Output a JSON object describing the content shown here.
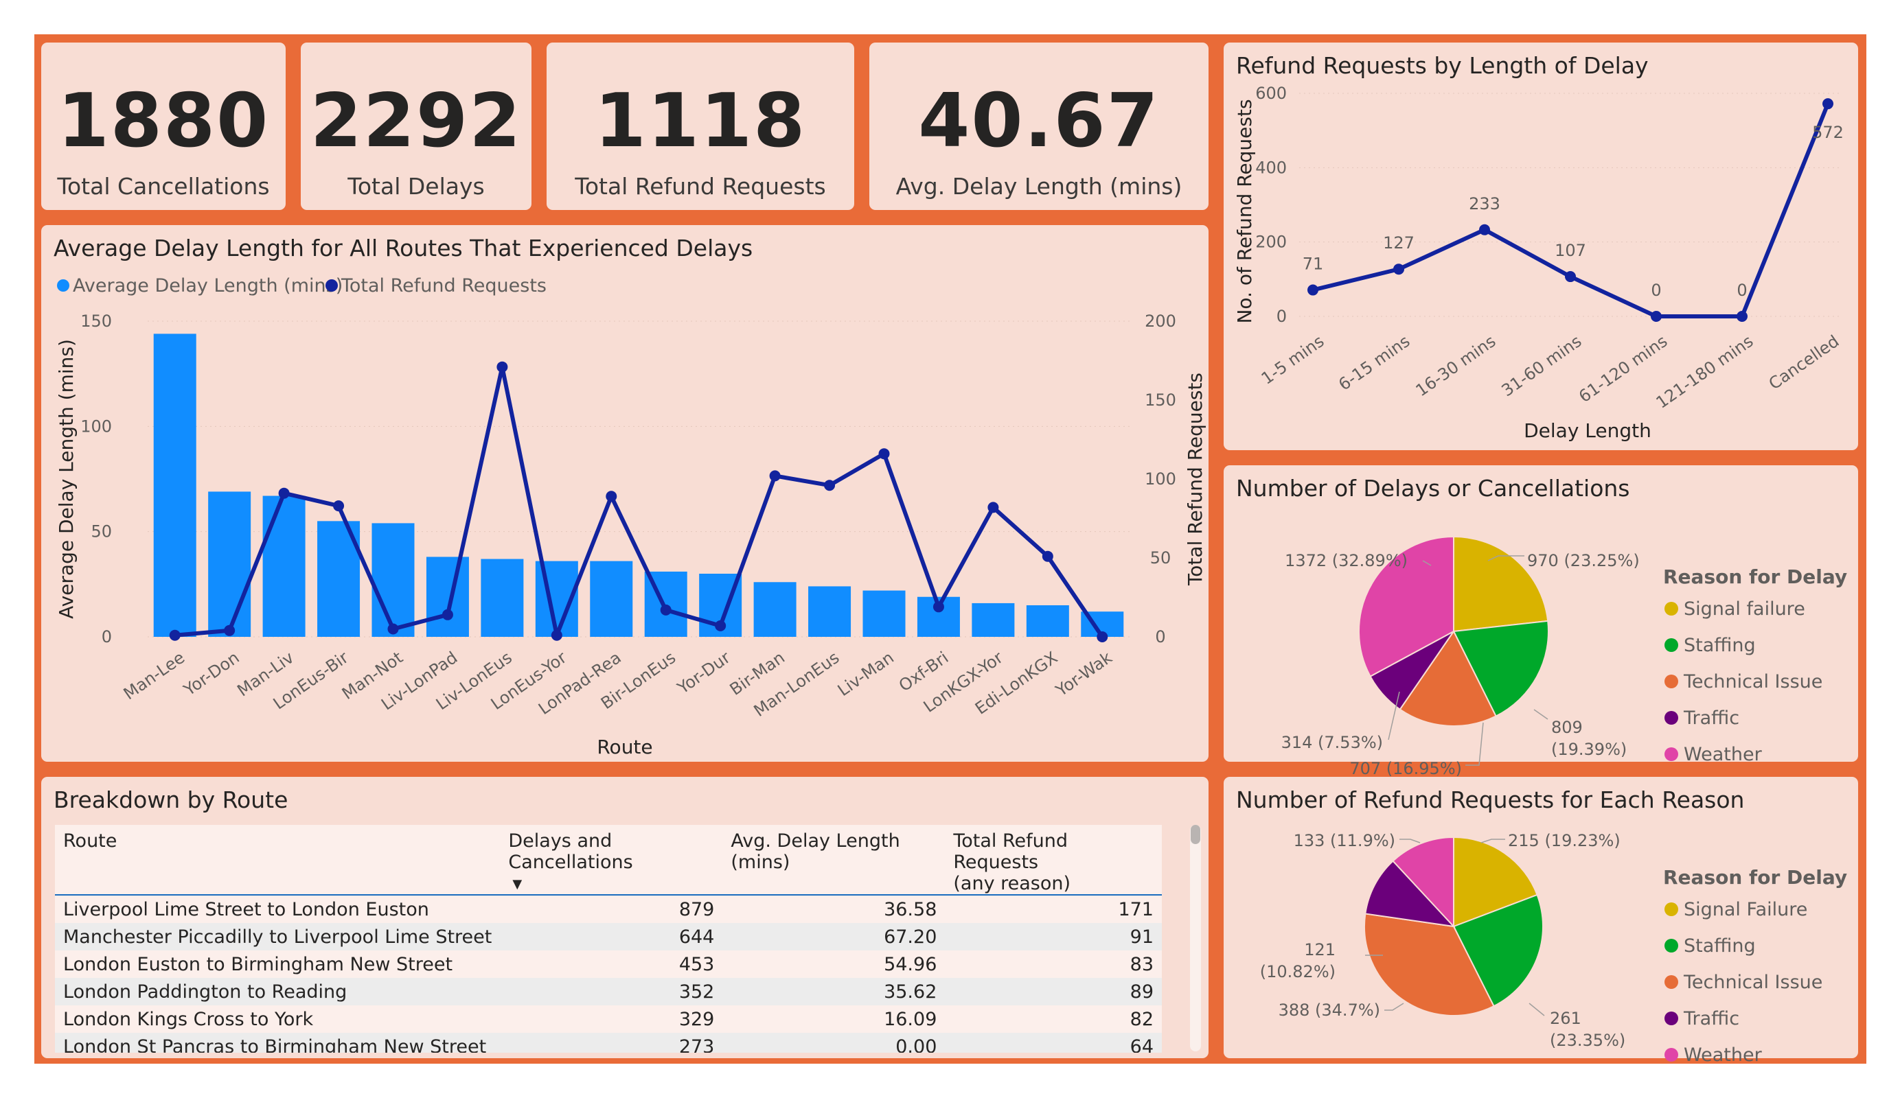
{
  "kpis": [
    {
      "value": "1880",
      "label": "Total Cancellations"
    },
    {
      "value": "2292",
      "label": "Total Delays"
    },
    {
      "value": "1118",
      "label": "Total Refund Requests"
    },
    {
      "value": "40.67",
      "label": "Avg. Delay Length (mins)"
    }
  ],
  "colors": {
    "background": "#e96b38",
    "card": "#f8ddd4",
    "bar": "#118dff",
    "line": "#12239e",
    "signal": "#d9b300",
    "staffing": "#00a82a",
    "technical": "#e66c37",
    "traffic": "#6b007b",
    "weather": "#e044a7"
  },
  "chart_data": [
    {
      "type": "bar",
      "title": "Average Delay Length for All Routes That Experienced Delays",
      "xlabel": "Route",
      "ylabel": "Average Delay Length (mins)",
      "y2label": "Total Refund Requests",
      "ylim": [
        0,
        150
      ],
      "y2lim": [
        0,
        200
      ],
      "yticks": [
        "150",
        "100",
        "50",
        "0"
      ],
      "y2ticks": [
        "200",
        "150",
        "100",
        "50",
        "0"
      ],
      "legend_position": "top-left",
      "categories": [
        "Man-Lee",
        "Yor-Don",
        "Man-Liv",
        "LonEus-Bir",
        "Man-Not",
        "Liv-LonPad",
        "Liv-LonEus",
        "LonEus-Yor",
        "LonPad-Rea",
        "Bir-LonEus",
        "Yor-Dur",
        "Bir-Man",
        "Man-LonEus",
        "Liv-Man",
        "Oxf-Bri",
        "LonKGX-Yor",
        "Edi-LonKGX",
        "Yor-Wak"
      ],
      "series": [
        {
          "name": "Average Delay Length (mins)",
          "kind": "bar",
          "axis": "left",
          "values": [
            144,
            69,
            67,
            55,
            54,
            38,
            37,
            36,
            36,
            31,
            30,
            26,
            24,
            22,
            19,
            16,
            15,
            12
          ]
        },
        {
          "name": "Total Refund Requests",
          "kind": "line",
          "axis": "right",
          "values": [
            1,
            4,
            91,
            83,
            5,
            14,
            171,
            1,
            89,
            17,
            7,
            102,
            96,
            116,
            19,
            82,
            51,
            0
          ]
        }
      ]
    },
    {
      "type": "line",
      "title": "Refund Requests by Length of Delay",
      "xlabel": "Delay Length",
      "ylabel": "No. of Refund Requests",
      "ylim": [
        0,
        600
      ],
      "yticks": [
        "600",
        "400",
        "200",
        "0"
      ],
      "categories": [
        "1-5 mins",
        "6-15 mins",
        "16-30 mins",
        "31-60 mins",
        "61-120 mins",
        "121-180 mins",
        "Cancelled"
      ],
      "values": [
        71,
        127,
        233,
        107,
        0,
        0,
        572
      ],
      "data_labels": [
        "71",
        "127",
        "233",
        "107",
        "0",
        "0",
        "572"
      ]
    },
    {
      "type": "pie",
      "title": "Number of Delays or Cancellations",
      "legend_title": "Reason for Delay",
      "legend_position": "right",
      "categories": [
        "Signal failure",
        "Staffing",
        "Technical Issue",
        "Traffic",
        "Weather"
      ],
      "values": [
        970,
        809,
        707,
        314,
        1372
      ],
      "data_labels": [
        "970 (23.25%)",
        "809",
        "(19.39%)",
        "707 (16.95%)",
        "314 (7.53%)",
        "1372 (32.89%)"
      ]
    },
    {
      "type": "pie",
      "title": "Number of Refund Requests for Each Reason",
      "legend_title": "Reason for Delay",
      "legend_position": "right",
      "categories": [
        "Signal Failure",
        "Staffing",
        "Technical Issue",
        "Traffic",
        "Weather"
      ],
      "values": [
        215,
        261,
        388,
        121,
        133
      ],
      "data_labels": [
        "215 (19.23%)",
        "261",
        "(23.35%)",
        "388 (34.7%)",
        "121",
        "(10.82%)",
        "133 (11.9%)"
      ]
    },
    {
      "type": "table",
      "title": "Breakdown by Route",
      "columns": [
        "Route",
        "Delays and Cancellations",
        "Avg. Delay Length (mins)",
        "Total Refund Requests (any reason)"
      ],
      "rows": [
        [
          "Liverpool Lime Street to London Euston",
          "879",
          "36.58",
          "171"
        ],
        [
          "Manchester Piccadilly to Liverpool Lime Street",
          "644",
          "67.20",
          "91"
        ],
        [
          "London Euston to Birmingham New Street",
          "453",
          "54.96",
          "83"
        ],
        [
          "London Paddington to Reading",
          "352",
          "35.62",
          "89"
        ],
        [
          "London Kings Cross to York",
          "329",
          "16.09",
          "82"
        ],
        [
          "London St Pancras to Birmingham New Street",
          "273",
          "0.00",
          "64"
        ]
      ]
    }
  ],
  "table": {
    "col1": "Route",
    "col2": "Delays and Cancellations",
    "col3": "Avg. Delay Length (mins)",
    "col4a": "Total Refund Requests",
    "col4b": "(any reason)",
    "sort_indicator": "▼"
  }
}
